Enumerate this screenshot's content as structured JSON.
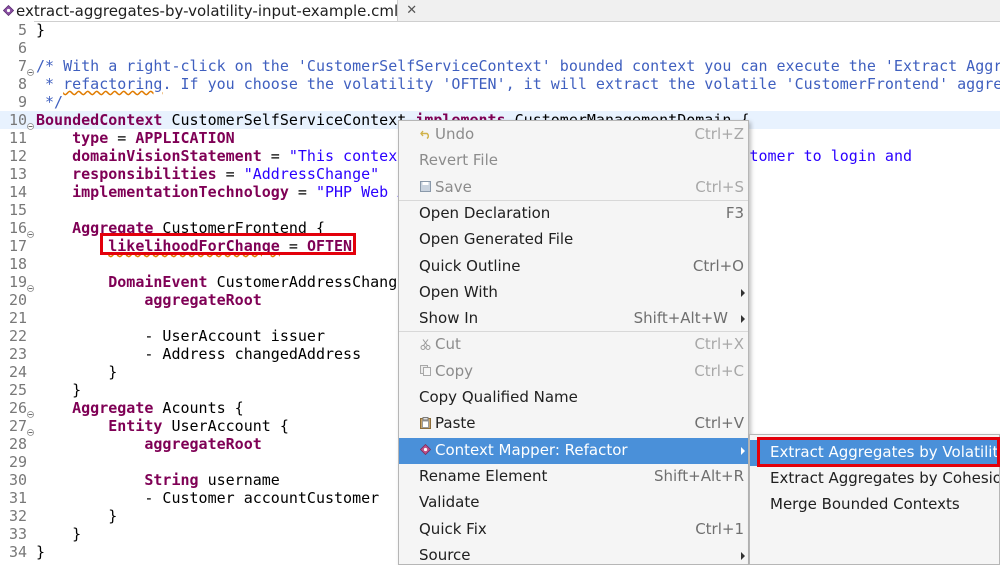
{
  "tab": {
    "title": "extract-aggregates-by-volatility-input-example.cml",
    "close": "✕"
  },
  "editor": {
    "lines": [
      {
        "num": "5",
        "fold": false,
        "segs": [
          {
            "t": "}",
            "c": ""
          }
        ]
      },
      {
        "num": "6",
        "fold": false,
        "segs": []
      },
      {
        "num": "7",
        "fold": true,
        "segs": [
          {
            "t": "/* With a right-click on the 'CustomerSelfServiceContext' bounded context you can execute the 'Extract Aggre",
            "c": "cm"
          }
        ]
      },
      {
        "num": "8",
        "fold": false,
        "segs": [
          {
            "t": " * ",
            "c": "cm"
          },
          {
            "t": "refactoring",
            "c": "cm cm-u"
          },
          {
            "t": ". If you choose the volatility 'OFTEN', it will extract the volatile 'CustomerFrontend' aggreg",
            "c": "cm"
          }
        ]
      },
      {
        "num": "9",
        "fold": false,
        "segs": [
          {
            "t": " */",
            "c": "cm"
          }
        ]
      },
      {
        "num": "10",
        "fold": true,
        "current": true,
        "segs": [
          {
            "t": "BoundedContext",
            "c": "kw"
          },
          {
            "t": " CustomerSelfServiceContext ",
            "c": ""
          },
          {
            "t": "implements",
            "c": "kw"
          },
          {
            "t": " CustomerManagementDomain {",
            "c": ""
          }
        ]
      },
      {
        "num": "11",
        "fold": false,
        "segs": [
          {
            "t": "    ",
            "c": ""
          },
          {
            "t": "type",
            "c": "kw"
          },
          {
            "t": " = ",
            "c": ""
          },
          {
            "t": "APPLICATION",
            "c": "kw"
          }
        ]
      },
      {
        "num": "12",
        "fold": false,
        "segs": [
          {
            "t": "    ",
            "c": ""
          },
          {
            "t": "domainVisionStatement",
            "c": "kw"
          },
          {
            "t": " = ",
            "c": ""
          },
          {
            "t": "\"This context",
            "c": "str"
          },
          {
            "t": "                          ",
            "c": ""
          },
          {
            "t": "lows the customer to login and",
            "c": "str"
          }
        ]
      },
      {
        "num": "13",
        "fold": false,
        "segs": [
          {
            "t": "    ",
            "c": ""
          },
          {
            "t": "responsibilities",
            "c": "kw"
          },
          {
            "t": " = ",
            "c": ""
          },
          {
            "t": "\"AddressChange\"",
            "c": "str"
          }
        ]
      },
      {
        "num": "14",
        "fold": false,
        "segs": [
          {
            "t": "    ",
            "c": ""
          },
          {
            "t": "implementationTechnology",
            "c": "kw"
          },
          {
            "t": " = ",
            "c": ""
          },
          {
            "t": "\"PHP Web A",
            "c": "str"
          }
        ]
      },
      {
        "num": "15",
        "fold": false,
        "segs": []
      },
      {
        "num": "16",
        "fold": true,
        "segs": [
          {
            "t": "    ",
            "c": ""
          },
          {
            "t": "Aggregate",
            "c": "kw"
          },
          {
            "t": " CustomerFrontend {",
            "c": ""
          }
        ]
      },
      {
        "num": "17",
        "fold": false,
        "segs": [
          {
            "t": "        ",
            "c": ""
          },
          {
            "t": "likelihoodForChange",
            "c": "kw cm-u"
          },
          {
            "t": " = ",
            "c": ""
          },
          {
            "t": "OFTEN",
            "c": "kw"
          }
        ]
      },
      {
        "num": "18",
        "fold": false,
        "segs": []
      },
      {
        "num": "19",
        "fold": true,
        "segs": [
          {
            "t": "        ",
            "c": ""
          },
          {
            "t": "DomainEvent",
            "c": "kw"
          },
          {
            "t": " CustomerAddressChange",
            "c": ""
          }
        ]
      },
      {
        "num": "20",
        "fold": false,
        "segs": [
          {
            "t": "            ",
            "c": ""
          },
          {
            "t": "aggregateRoot",
            "c": "kw"
          }
        ]
      },
      {
        "num": "21",
        "fold": false,
        "segs": []
      },
      {
        "num": "22",
        "fold": false,
        "segs": [
          {
            "t": "            - UserAccount issuer",
            "c": ""
          }
        ]
      },
      {
        "num": "23",
        "fold": false,
        "segs": [
          {
            "t": "            - Address changedAddress",
            "c": ""
          }
        ]
      },
      {
        "num": "24",
        "fold": false,
        "segs": [
          {
            "t": "        }",
            "c": ""
          }
        ]
      },
      {
        "num": "25",
        "fold": false,
        "segs": [
          {
            "t": "    }",
            "c": ""
          }
        ]
      },
      {
        "num": "26",
        "fold": true,
        "segs": [
          {
            "t": "    ",
            "c": ""
          },
          {
            "t": "Aggregate",
            "c": "kw"
          },
          {
            "t": " Acounts {",
            "c": ""
          }
        ]
      },
      {
        "num": "27",
        "fold": true,
        "segs": [
          {
            "t": "        ",
            "c": ""
          },
          {
            "t": "Entity",
            "c": "kw"
          },
          {
            "t": " UserAccount {",
            "c": ""
          }
        ]
      },
      {
        "num": "28",
        "fold": false,
        "segs": [
          {
            "t": "            ",
            "c": ""
          },
          {
            "t": "aggregateRoot",
            "c": "kw"
          }
        ]
      },
      {
        "num": "29",
        "fold": false,
        "segs": []
      },
      {
        "num": "30",
        "fold": false,
        "segs": [
          {
            "t": "            ",
            "c": ""
          },
          {
            "t": "String",
            "c": "kw"
          },
          {
            "t": " username",
            "c": ""
          }
        ]
      },
      {
        "num": "31",
        "fold": false,
        "segs": [
          {
            "t": "            - Customer accountCustomer",
            "c": ""
          }
        ]
      },
      {
        "num": "32",
        "fold": false,
        "segs": [
          {
            "t": "        }",
            "c": ""
          }
        ]
      },
      {
        "num": "33",
        "fold": false,
        "segs": [
          {
            "t": "    }",
            "c": ""
          }
        ]
      },
      {
        "num": "34",
        "fold": false,
        "segs": [
          {
            "t": "}",
            "c": ""
          }
        ]
      }
    ]
  },
  "context_menu": {
    "items": [
      {
        "label": "Undo",
        "shortcut": "Ctrl+Z",
        "disabled": true,
        "icon": "undo-icon"
      },
      {
        "label": "Revert File",
        "shortcut": "",
        "disabled": true
      },
      {
        "label": "Save",
        "shortcut": "Ctrl+S",
        "disabled": true,
        "icon": "save-icon"
      },
      {
        "sep": true
      },
      {
        "label": "Open Declaration",
        "shortcut": "F3"
      },
      {
        "label": "Open Generated File",
        "shortcut": ""
      },
      {
        "label": "Quick Outline",
        "shortcut": "Ctrl+O"
      },
      {
        "label": "Open With",
        "shortcut": "",
        "submenu": true
      },
      {
        "label": "Show In",
        "shortcut": "Shift+Alt+W",
        "submenu": true
      },
      {
        "sep": true
      },
      {
        "label": "Cut",
        "shortcut": "Ctrl+X",
        "disabled": true,
        "icon": "cut-icon"
      },
      {
        "label": "Copy",
        "shortcut": "Ctrl+C",
        "disabled": true,
        "icon": "copy-icon"
      },
      {
        "label": "Copy Qualified Name",
        "shortcut": ""
      },
      {
        "label": "Paste",
        "shortcut": "Ctrl+V",
        "icon": "paste-icon"
      },
      {
        "label": "Context Mapper: Refactor",
        "shortcut": "",
        "submenu": true,
        "active": true,
        "icon": "context-mapper-icon"
      },
      {
        "label": "Rename Element",
        "shortcut": "Shift+Alt+R"
      },
      {
        "label": "Validate",
        "shortcut": ""
      },
      {
        "label": "Quick Fix",
        "shortcut": "Ctrl+1"
      },
      {
        "label": "Source",
        "shortcut": "",
        "submenu": true
      }
    ]
  },
  "submenu": {
    "items": [
      {
        "label": "Extract Aggregates by Volatility",
        "active": true
      },
      {
        "label": "Extract Aggregates by Cohesion"
      },
      {
        "label": "Merge Bounded Contexts"
      }
    ]
  },
  "colors": {
    "keyword": "#7f0055",
    "string": "#2a00ff",
    "comment": "#3f5fbf",
    "highlight": "#e3000b",
    "menu_active": "#4a90d9",
    "current_line": "#e8f2fe"
  }
}
